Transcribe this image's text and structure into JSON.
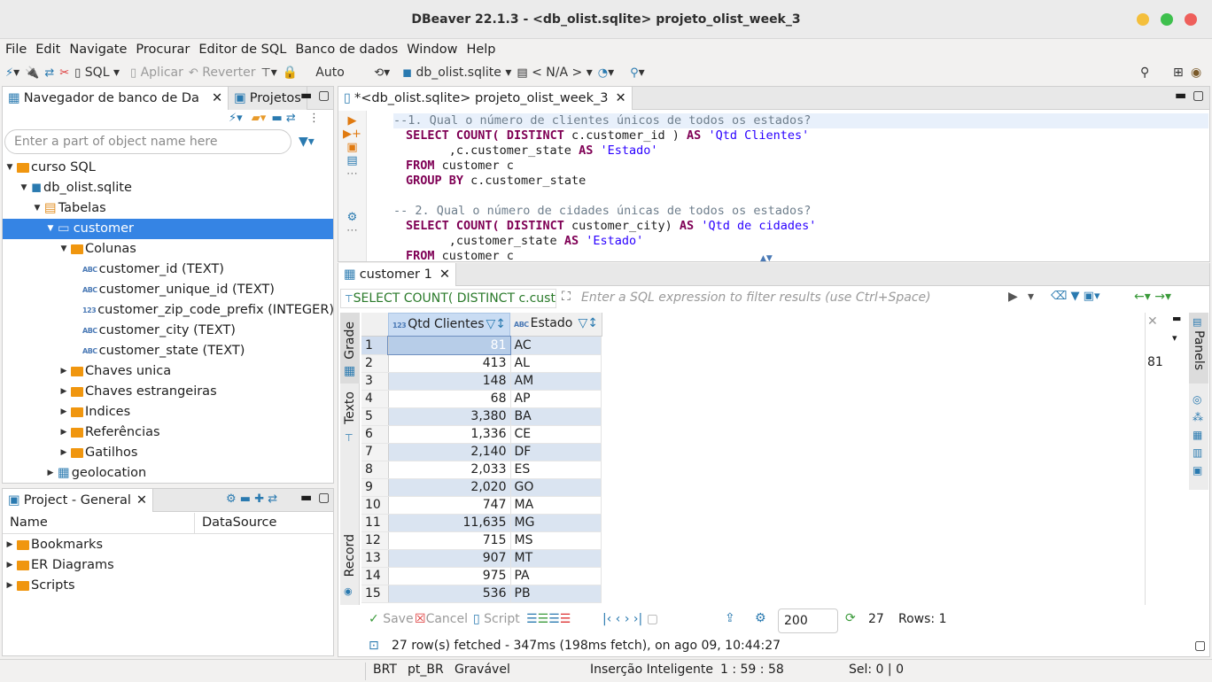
{
  "window": {
    "title": "DBeaver 22.1.3 - <db_olist.sqlite> projeto_olist_week_3"
  },
  "menu": [
    "File",
    "Edit",
    "Navigate",
    "Procurar",
    "Editor de SQL",
    "Banco de dados",
    "Window",
    "Help"
  ],
  "toolbar": {
    "sql": "SQL",
    "apply": "Aplicar",
    "revert": "Reverter",
    "auto": "Auto",
    "datasource": "db_olist.sqlite",
    "schema": "< N/A >"
  },
  "navigator": {
    "tab1": "Navegador de banco de Da",
    "tab2": "Projetos",
    "search_placeholder": "Enter a part of object name here",
    "tree": {
      "root": "curso SQL",
      "db": "db_olist.sqlite",
      "tables": "Tabelas",
      "customer": "customer",
      "columns_folder": "Colunas",
      "columns": [
        {
          "type": "ABC",
          "label": "customer_id (TEXT)"
        },
        {
          "type": "ABC",
          "label": "customer_unique_id (TEXT)"
        },
        {
          "type": "123",
          "label": "customer_zip_code_prefix (INTEGER)"
        },
        {
          "type": "ABC",
          "label": "customer_city (TEXT)"
        },
        {
          "type": "ABC",
          "label": "customer_state (TEXT)"
        }
      ],
      "folders": [
        "Chaves unica",
        "Chaves estrangeiras",
        "Indices",
        "Referências",
        "Gatilhos"
      ],
      "geolocation": "geolocation"
    }
  },
  "project": {
    "tab": "Project - General",
    "col_name": "Name",
    "col_ds": "DataSource",
    "items": [
      "Bookmarks",
      "ER Diagrams",
      "Scripts"
    ]
  },
  "editor": {
    "tab": "*<db_olist.sqlite> projeto_olist_week_3",
    "lines": [
      {
        "t": "cm",
        "s": "--1. Qual o número de clientes únicos de todos os estados?"
      },
      {
        "t": "q1a"
      },
      {
        "t": "q1b"
      },
      {
        "t": "q1c"
      },
      {
        "t": "q1d"
      },
      {
        "t": "blank"
      },
      {
        "t": "cm",
        "s": "-- 2. Qual o número de cidades únicas de todos os estados?"
      },
      {
        "t": "q2a"
      },
      {
        "t": "q2b"
      },
      {
        "t": "q2c"
      }
    ],
    "sql": {
      "select": "SELECT",
      "count": "COUNT(",
      "distinct": "DISTINCT",
      "as": "AS",
      "from": "FROM",
      "groupby": "GROUP BY",
      "q1_col": " c.customer_id ) ",
      "q1_alias": "'Qtd Clientes'",
      "q1_state": "      ,c.customer_state ",
      "q1_estado": "'Estado'",
      "q1_from": " customer c",
      "q1_group": " c.customer_state",
      "q2_col": " customer_city) ",
      "q2_alias": "'Qtd de cidades'",
      "q2_state": "      ,customer_state ",
      "q2_estado": "'Estado'",
      "q2_from": " customer c"
    }
  },
  "results": {
    "tab": "customer 1",
    "query_preview": "SELECT COUNT( DISTINCT c.custo",
    "filter_placeholder": "Enter a SQL expression to filter results (use Ctrl+Space)",
    "columns": [
      {
        "type": "123",
        "name": "Qtd Clientes"
      },
      {
        "type": "ABC",
        "name": "Estado"
      }
    ],
    "rows": [
      [
        "1",
        "81",
        "AC"
      ],
      [
        "2",
        "413",
        "AL"
      ],
      [
        "3",
        "148",
        "AM"
      ],
      [
        "4",
        "68",
        "AP"
      ],
      [
        "5",
        "3,380",
        "BA"
      ],
      [
        "6",
        "1,336",
        "CE"
      ],
      [
        "7",
        "2,140",
        "DF"
      ],
      [
        "8",
        "2,033",
        "ES"
      ],
      [
        "9",
        "2,020",
        "GO"
      ],
      [
        "10",
        "747",
        "MA"
      ],
      [
        "11",
        "11,635",
        "MG"
      ],
      [
        "12",
        "715",
        "MS"
      ],
      [
        "13",
        "907",
        "MT"
      ],
      [
        "14",
        "975",
        "PA"
      ],
      [
        "15",
        "536",
        "PB"
      ]
    ],
    "side_tabs": {
      "grade": "Grade",
      "texto": "Texto",
      "record": "Record"
    },
    "panel_value": "81",
    "panels_label": "Panels",
    "bottom": {
      "save": "Save",
      "cancel": "Cancel",
      "script": "Script",
      "limit": "200",
      "count": "27",
      "rows": "Rows: 1"
    },
    "fetch_status": "27 row(s) fetched - 347ms (198ms fetch), on ago 09, 10:44:27"
  },
  "status": {
    "tz": "BRT",
    "locale": "pt_BR",
    "mode": "Gravável",
    "insert": "Inserção Inteligente",
    "pos": "1 : 59 : 58",
    "sel": "Sel: 0 | 0"
  }
}
